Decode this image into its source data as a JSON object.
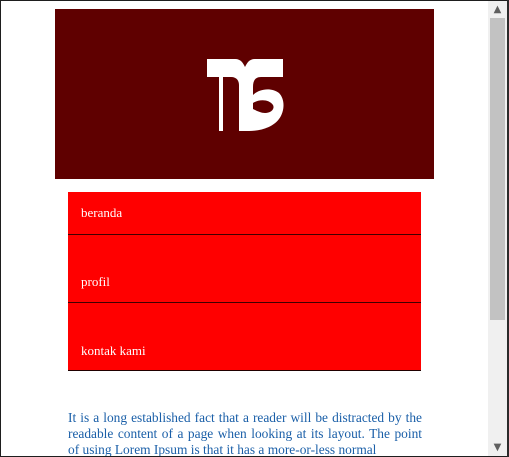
{
  "colors": {
    "banner": "#5f0000",
    "nav_background": "#ff0000",
    "nav_text": "#ffffff",
    "body_text": "#1a5fa8"
  },
  "header": {
    "logo_icon": "ts-logo-icon"
  },
  "nav": {
    "items": [
      {
        "label": "beranda"
      },
      {
        "label": "profil"
      },
      {
        "label": "kontak kami"
      }
    ]
  },
  "content": {
    "paragraph": "It is a long established fact that a reader will be distracted by the readable content of a page when looking at its layout. The point of using Lorem Ipsum is that it has a more-or-less normal"
  },
  "scrollbar": {
    "up_icon": "chevron-up-icon",
    "down_icon": "chevron-down-icon",
    "up_glyph": "▲",
    "down_glyph": "▼"
  }
}
